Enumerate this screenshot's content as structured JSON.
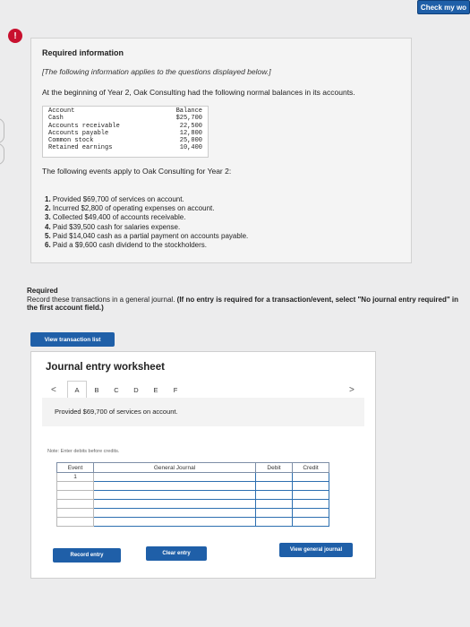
{
  "header": {
    "check_label": "Check my wo"
  },
  "alert": {
    "icon_text": "!"
  },
  "info": {
    "title": "Required information",
    "note": "[The following information applies to the questions displayed below.]",
    "intro": "At the beginning of Year 2, Oak Consulting had the following normal balances in its accounts.",
    "balances": {
      "header": {
        "account": "Account",
        "balance": "Balance"
      },
      "rows": [
        {
          "account": "Cash",
          "balance": "$25,700"
        },
        {
          "account": "Accounts receivable",
          "balance": "22,500"
        },
        {
          "account": "Accounts payable",
          "balance": "12,800"
        },
        {
          "account": "Common stock",
          "balance": "25,000"
        },
        {
          "account": "Retained earnings",
          "balance": "10,400"
        }
      ]
    },
    "events_intro": "The following events apply to Oak Consulting for Year 2:",
    "events": [
      {
        "num": "1.",
        "text": "Provided $69,700 of services on account."
      },
      {
        "num": "2.",
        "text": "Incurred $2,800 of operating expenses on account."
      },
      {
        "num": "3.",
        "text": "Collected $49,400 of accounts receivable."
      },
      {
        "num": "4.",
        "text": "Paid $39,500 cash for salaries expense."
      },
      {
        "num": "5.",
        "text": "Paid $14,040 cash as a partial payment on accounts payable."
      },
      {
        "num": "6.",
        "text": "Paid a $9,600 cash dividend to the stockholders."
      }
    ]
  },
  "required": {
    "title": "Required",
    "instruction": "Record these transactions in a general journal.",
    "instruction_bold": "(If no entry is required for a transaction/event, select \"No journal entry required\" in the first account field.)"
  },
  "buttons": {
    "view_transaction_list": "View transaction list",
    "record_entry": "Record entry",
    "clear_entry": "Clear entry",
    "view_general_journal": "View general journal"
  },
  "worksheet": {
    "title": "Journal entry worksheet",
    "prev_icon": "<",
    "next_icon": ">",
    "tabs": [
      "A",
      "B",
      "C",
      "D",
      "E",
      "F"
    ],
    "active_tab": "A",
    "event_description": "Provided $69,700 of services on account.",
    "note": "Note: Enter debits before credits.",
    "table": {
      "headers": {
        "event": "Event",
        "general_journal": "General Journal",
        "debit": "Debit",
        "credit": "Credit"
      },
      "event_number": "1"
    }
  },
  "colors": {
    "primary_button": "#1f5fa8",
    "alert": "#c8102e"
  }
}
